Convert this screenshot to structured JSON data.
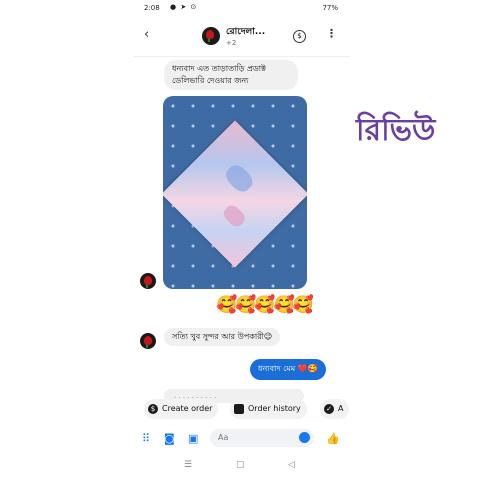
{
  "status_bar": {
    "time": "2:08",
    "left_icons": "● ➤ ⊙",
    "battery": "77%"
  },
  "header": {
    "back_icon": "‹",
    "title": "রোদেলা...",
    "subtitle": "+2",
    "dollar_icon": "$",
    "more_icon": "⋮"
  },
  "messages": {
    "m1": "ধন্যবাদ এত তাড়াতাড়ি প্রডাক্ট ডেলিভারি দেওয়ার জন্য",
    "emoji_row": "🥰🥰🥰🥰🥰",
    "m2": "সত্যি খুব সুন্দর আর উপকারী😉",
    "m3": "ধন্যবাদ মেম ❤️🥰",
    "m4_partial": "·  ·  ·  · ·  ·  ·  · · ·"
  },
  "actions": {
    "create_order": "Create order",
    "order_history": "Order history",
    "third": "A"
  },
  "composer": {
    "placeholder": "Aa"
  },
  "navbar": {
    "menu": "☰",
    "home": "▢",
    "back": "◁"
  },
  "overlay_text": "রিভিউ",
  "colors": {
    "accent_blue": "#1a6ed8",
    "overlay_purple": "#6a3fa0",
    "bubble_gray": "#f0f0f0"
  }
}
